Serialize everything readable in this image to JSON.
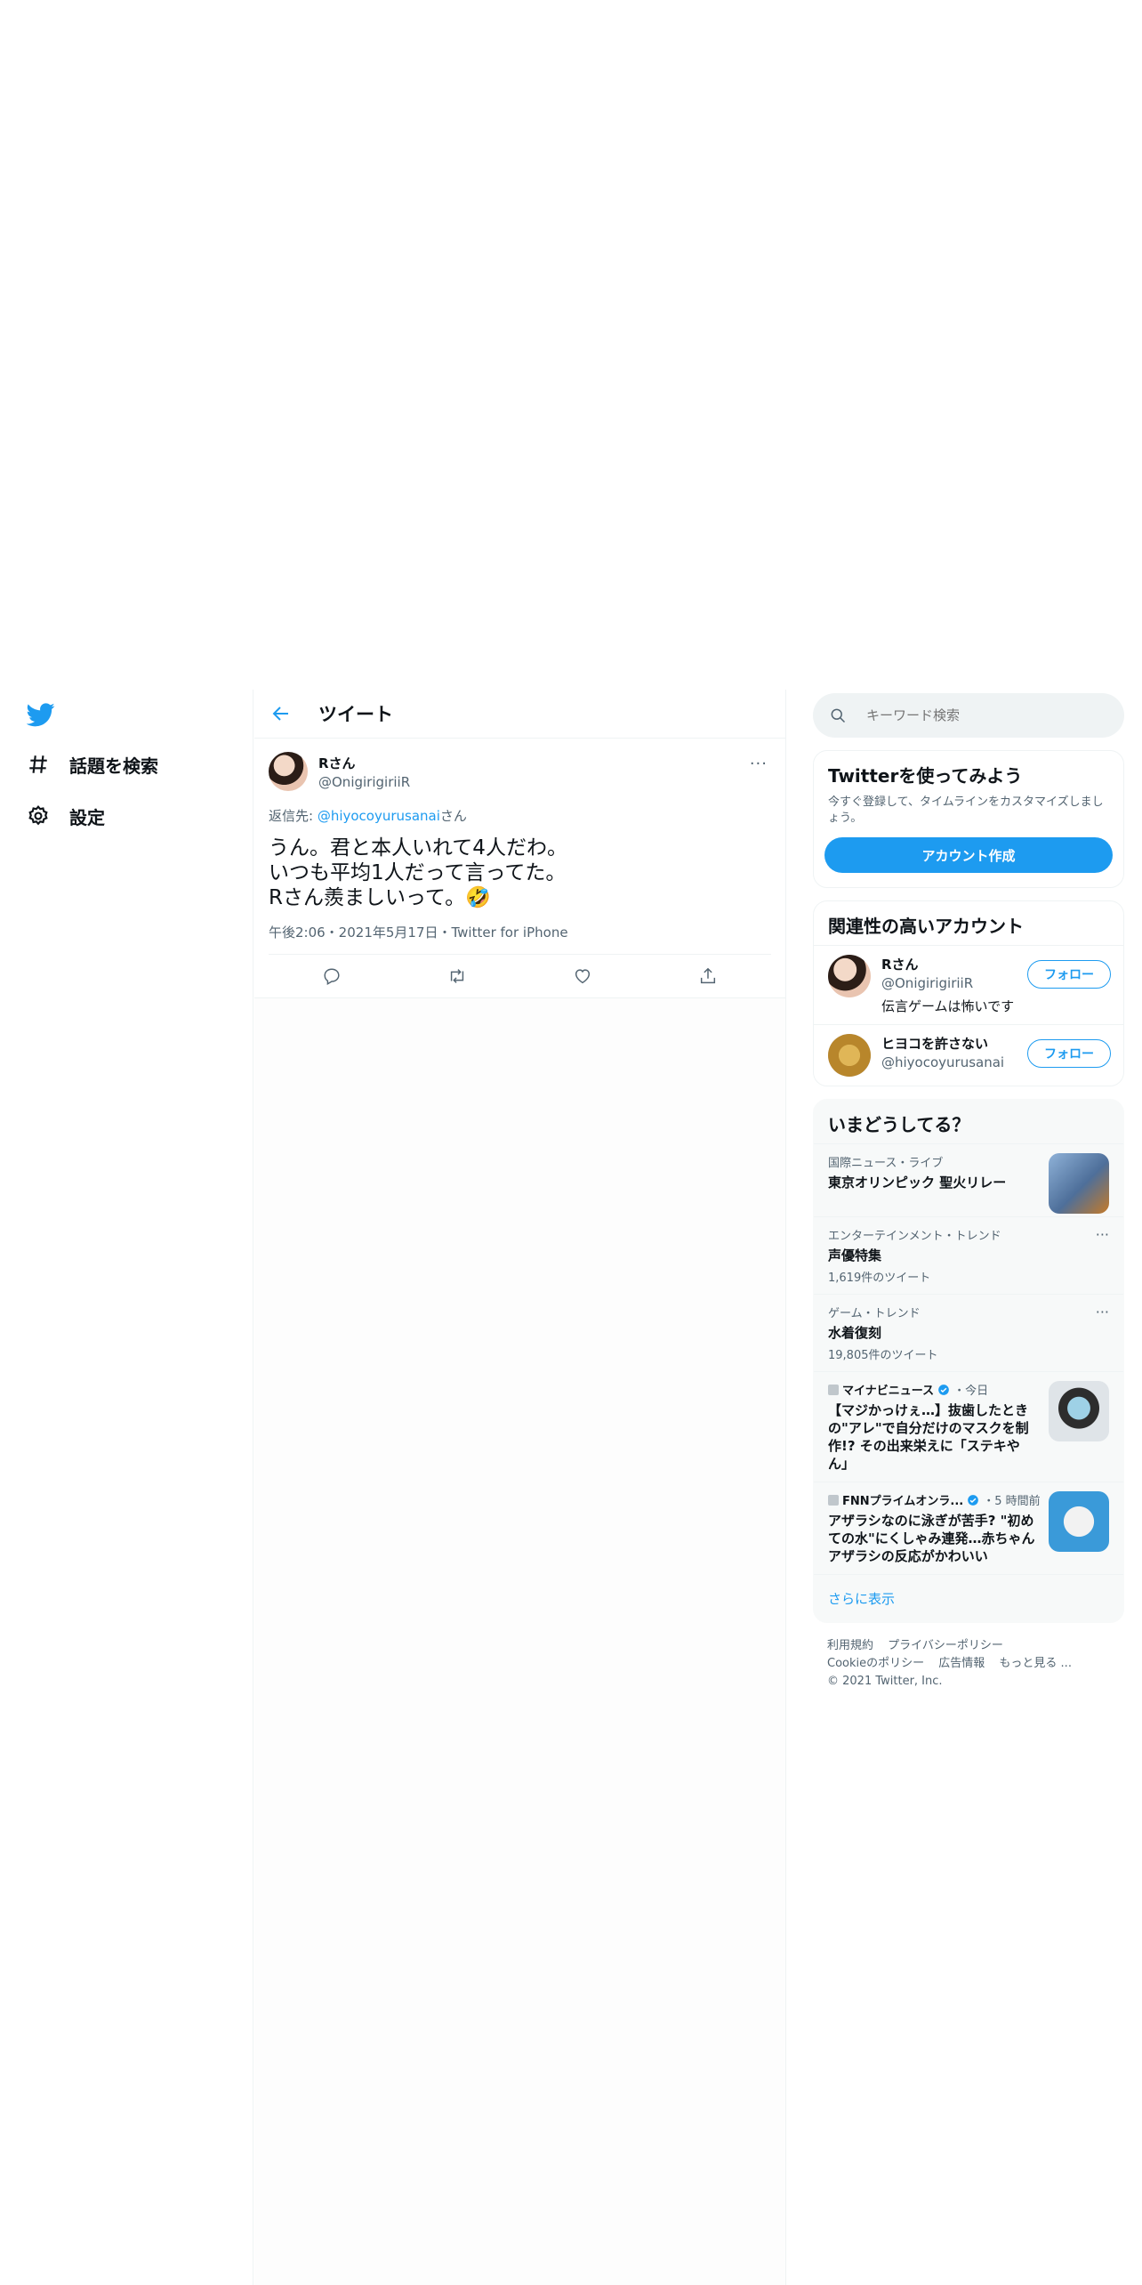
{
  "nav": {
    "explore_label": "話題を検索",
    "settings_label": "設定"
  },
  "header": {
    "title": "ツイート"
  },
  "tweet": {
    "author_name": "Rさん",
    "author_handle": "@OnigirigiriiR",
    "more": "···",
    "reply_prefix": "返信先: ",
    "reply_mention": "@hiyocoyurusanai",
    "reply_suffix": "さん",
    "text": "うん。君と本人いれて4人だわ。\nいつも平均1人だって言ってた。\nRさん羨ましいって。🤣",
    "meta": "午後2:06・2021年5月17日・Twitter for iPhone"
  },
  "search": {
    "placeholder": "キーワード検索"
  },
  "signup": {
    "title": "Twitterを使ってみよう",
    "desc": "今すぐ登録して、タイムラインをカスタマイズしましょう。",
    "button": "アカウント作成"
  },
  "related": {
    "title": "関連性の高いアカウント",
    "follow_label": "フォロー",
    "accounts": [
      {
        "name": "Rさん",
        "handle": "@OnigirigiriiR",
        "bio": "伝言ゲームは怖いです"
      },
      {
        "name": "ヒヨコを許さない",
        "handle": "@hiyocoyurusanai",
        "bio": ""
      }
    ]
  },
  "trends": {
    "title": "いまどうしてる？",
    "items": [
      {
        "context": "国際ニュース・ライブ",
        "title": "東京オリンピック 聖火リレー",
        "count": ""
      },
      {
        "context": "エンターテインメント・トレンド",
        "title": "声優特集",
        "count": "1,619件のツイート"
      },
      {
        "context": "ゲーム・トレンド",
        "title": "水着復刻",
        "count": "19,805件のツイート"
      },
      {
        "source": "マイナビニュース",
        "time": "・今日",
        "title": "【マジかっけぇ…】抜歯したときの\"アレ\"で自分だけのマスクを制作!? その出来栄えに「ステキやん」"
      },
      {
        "source": "FNNプライムオンラ...",
        "time": "・5 時間前",
        "title": "アザラシなのに泳ぎが苦手? \"初めての水\"にくしゃみ連発…赤ちゃんアザラシの反応がかわいい"
      }
    ],
    "show_more": "さらに表示"
  },
  "footer": {
    "terms": "利用規約",
    "privacy": "プライバシーポリシー",
    "cookie": "Cookieのポリシー",
    "ads": "広告情報",
    "more": "もっと見る ...",
    "copyright": "© 2021 Twitter, Inc."
  },
  "colors": {
    "accent": "#1d9bf0",
    "text": "#0f1419",
    "secondary": "#536471"
  },
  "icons": [
    "twitter-logo-icon",
    "hashtag-icon",
    "gear-icon",
    "back-arrow-icon",
    "search-icon",
    "reply-icon",
    "retweet-icon",
    "like-icon",
    "share-icon",
    "verified-icon"
  ]
}
